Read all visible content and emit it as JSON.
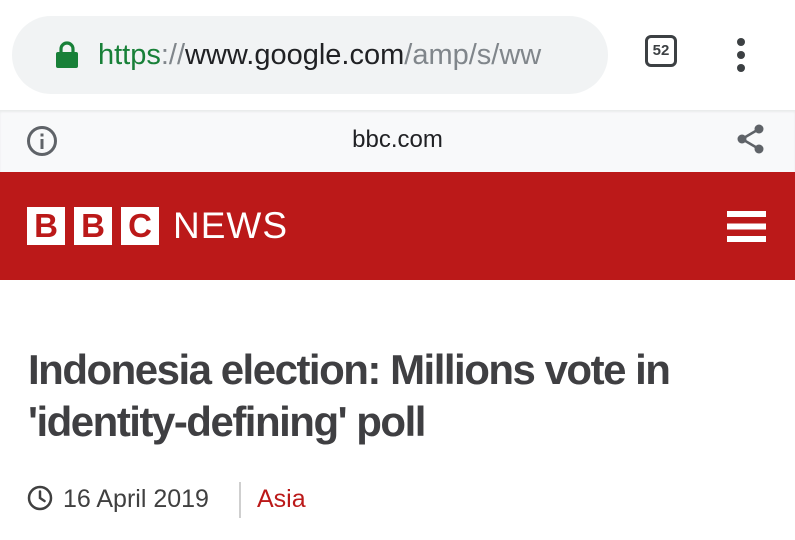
{
  "browser": {
    "url": {
      "scheme": "https",
      "separator": "://",
      "host": "www.google.com",
      "path": "/amp/s/ww"
    },
    "tab_count": "52",
    "icons": {
      "lock": "lock-icon",
      "menu": "more-vert-icon"
    }
  },
  "amp_bar": {
    "domain": "bbc.com",
    "icons": {
      "info": "info-icon",
      "share": "share-icon"
    }
  },
  "site_header": {
    "logo_letters": [
      "B",
      "B",
      "C"
    ],
    "logo_word": "NEWS",
    "icons": {
      "menu": "hamburger-menu-icon"
    }
  },
  "article": {
    "headline": "Indonesia election: Millions vote in 'identity-defining' poll",
    "date": "16 April 2019",
    "section": "Asia"
  },
  "colors": {
    "bbc_red": "#bb1919",
    "secure_green": "#188038",
    "headline_text": "#3f3f42"
  }
}
